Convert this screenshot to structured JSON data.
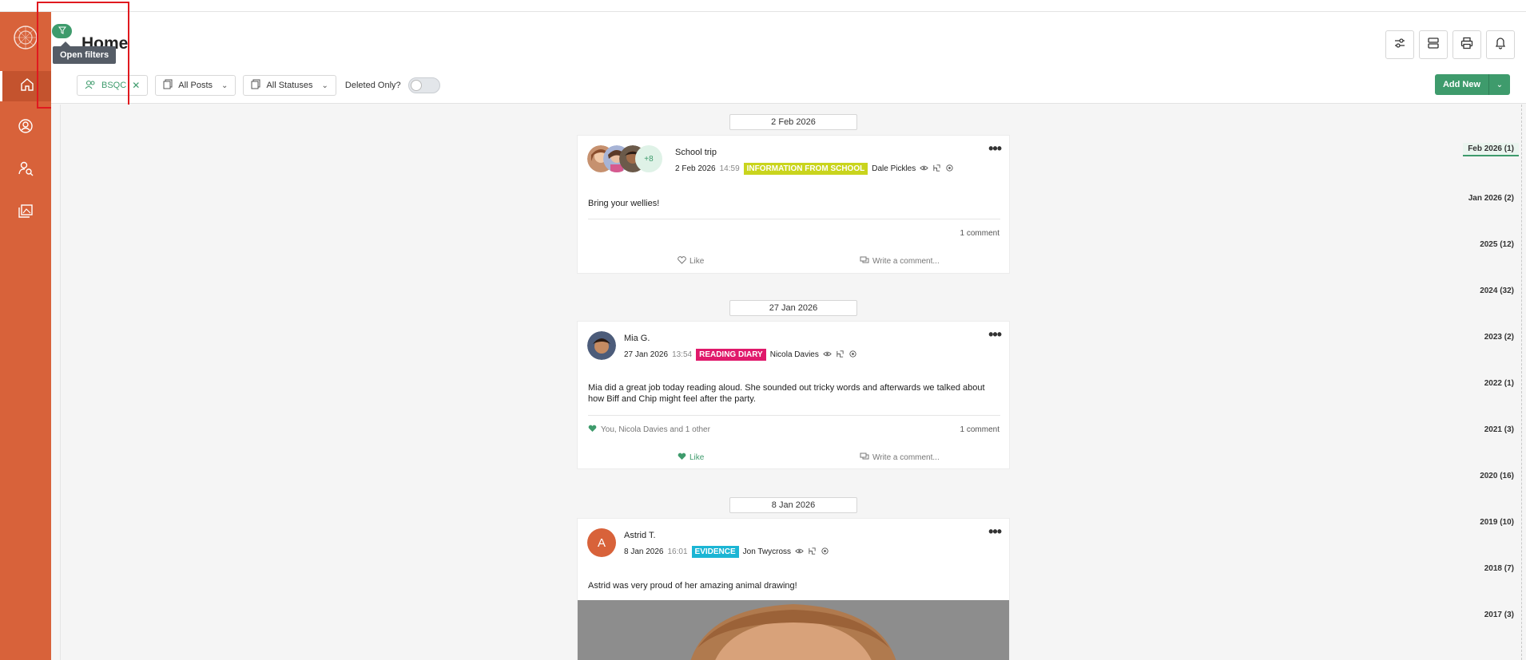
{
  "app": {
    "title": "Home",
    "accent": "#d8623a",
    "green": "#3e9b6c"
  },
  "filters": {
    "tooltip": "Open filters",
    "group_chip": "BSQC",
    "posts_select": "All Posts",
    "status_select": "All Statuses",
    "deleted_label": "Deleted Only?"
  },
  "actions": {
    "add_new": "Add New"
  },
  "sidebar": {
    "items": [
      {
        "icon": "home-icon"
      },
      {
        "icon": "user-circle-icon"
      },
      {
        "icon": "user-search-icon"
      },
      {
        "icon": "gallery-icon"
      }
    ]
  },
  "feed": {
    "dates": [
      "2 Feb 2026",
      "27 Jan 2026",
      "8 Jan 2026"
    ],
    "posts": [
      {
        "author": "School trip",
        "date": "2 Feb 2026",
        "time": "14:59",
        "tag": "INFORMATION FROM SCHOOL",
        "tag_color": "#c9d41d",
        "staff": "Dale Pickles",
        "avatar_more": "+8",
        "body": "Bring your wellies!",
        "comments": "1 comment",
        "like": "Like",
        "comment_prompt": "Write a comment..."
      },
      {
        "author": "Mia G.",
        "date": "27 Jan 2026",
        "time": "13:54",
        "tag": "READING DIARY",
        "tag_color": "#e0196b",
        "staff": "Nicola Davies",
        "body": "Mia did a great job today reading aloud. She sounded out tricky words and afterwards we talked about how Biff and Chip might feel after the party.",
        "likers": "You, Nicola Davies and 1 other",
        "comments": "1 comment",
        "like": "Like",
        "comment_prompt": "Write a comment..."
      },
      {
        "author": "Astrid T.",
        "avatar_letter": "A",
        "date": "8 Jan 2026",
        "time": "16:01",
        "tag": "EVIDENCE",
        "tag_color": "#1bb5d4",
        "staff": "Jon Twycross",
        "body": "Astrid was very proud of her amazing animal drawing!"
      }
    ]
  },
  "timeline": [
    "Feb 2026 (1)",
    "Jan 2026 (2)",
    "2025 (12)",
    "2024 (32)",
    "2023 (2)",
    "2022 (1)",
    "2021 (3)",
    "2020 (16)",
    "2019 (10)",
    "2018 (7)",
    "2017 (3)"
  ]
}
